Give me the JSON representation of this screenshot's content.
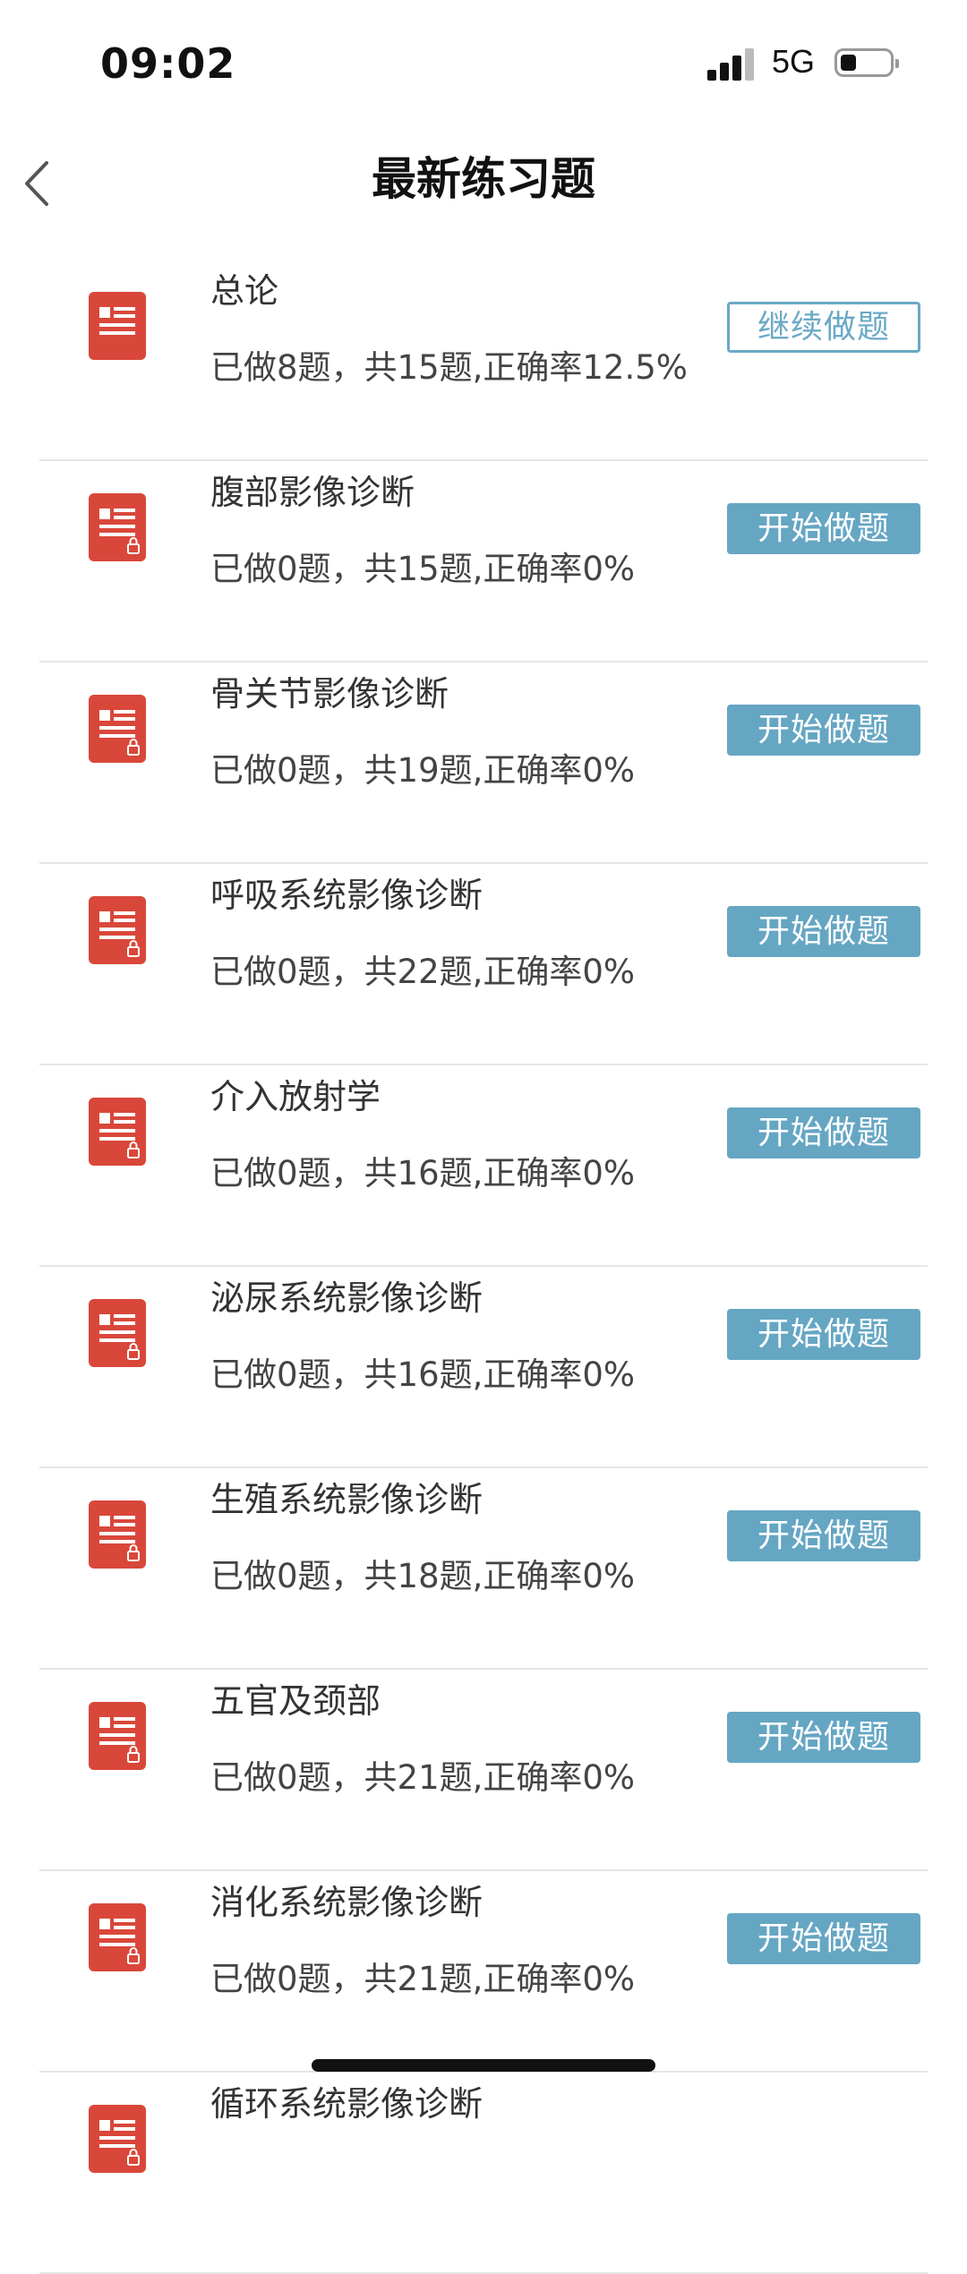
{
  "status_bar": {
    "time": "09:02",
    "network": "5G",
    "icons": [
      "signal-icon",
      "battery-icon"
    ]
  },
  "header": {
    "title": "最新练习题",
    "back_icon": "chevron-left-icon"
  },
  "colors": {
    "accent_button": "#65a6c3",
    "doc_icon_red": "#d9473a",
    "divider": "#e6e6e6"
  },
  "items": [
    {
      "title": "总论",
      "stats": "已做8题，共15题,正确率12.5%",
      "button": "继续做题",
      "button_style": "outline",
      "locked": false
    },
    {
      "title": "腹部影像诊断",
      "stats": "已做0题，共15题,正确率0%",
      "button": "开始做题",
      "button_style": "filled",
      "locked": true
    },
    {
      "title": "骨关节影像诊断",
      "stats": "已做0题，共19题,正确率0%",
      "button": "开始做题",
      "button_style": "filled",
      "locked": true
    },
    {
      "title": "呼吸系统影像诊断",
      "stats": "已做0题，共22题,正确率0%",
      "button": "开始做题",
      "button_style": "filled",
      "locked": true
    },
    {
      "title": "介入放射学",
      "stats": "已做0题，共16题,正确率0%",
      "button": "开始做题",
      "button_style": "filled",
      "locked": true
    },
    {
      "title": "泌尿系统影像诊断",
      "stats": "已做0题，共16题,正确率0%",
      "button": "开始做题",
      "button_style": "filled",
      "locked": true
    },
    {
      "title": "生殖系统影像诊断",
      "stats": "已做0题，共18题,正确率0%",
      "button": "开始做题",
      "button_style": "filled",
      "locked": true
    },
    {
      "title": "五官及颈部",
      "stats": "已做0题，共21题,正确率0%",
      "button": "开始做题",
      "button_style": "filled",
      "locked": true
    },
    {
      "title": "消化系统影像诊断",
      "stats": "已做0题，共21题,正确率0%",
      "button": "开始做题",
      "button_style": "filled",
      "locked": true
    },
    {
      "title": "循环系统影像诊断",
      "stats": "",
      "button": "",
      "button_style": "filled",
      "locked": true
    }
  ]
}
